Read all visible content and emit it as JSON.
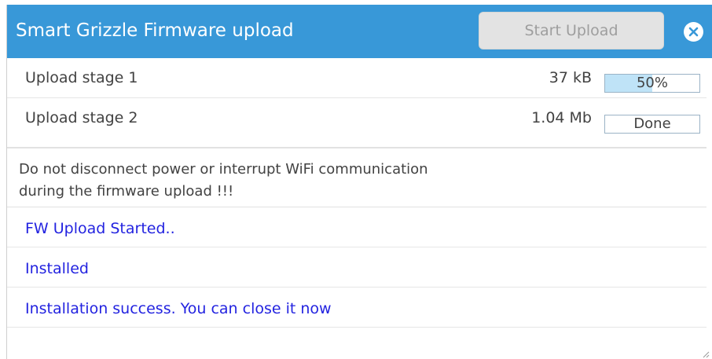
{
  "window": {
    "title": "Smart Grizzle Firmware upload",
    "start_button_label": "Start Upload",
    "accent_color": "#3898d8"
  },
  "stages": [
    {
      "label": "Upload stage 1",
      "size": "37 kB",
      "status": "50%",
      "progress_percent": 50
    },
    {
      "label": "Upload stage 2",
      "size": "1.04 Mb",
      "status": "Done",
      "progress_percent": 0
    }
  ],
  "warning": {
    "line1": "Do not disconnect power or interrupt WiFi communication",
    "line2": "during the firmware upload !!!"
  },
  "log": [
    "FW Upload Started..",
    "Installed",
    "Installation success. You can close it now"
  ],
  "log_color": "#2323e0",
  "icons": {
    "close": "close-circle-icon",
    "resize": "resize-grip-icon"
  }
}
